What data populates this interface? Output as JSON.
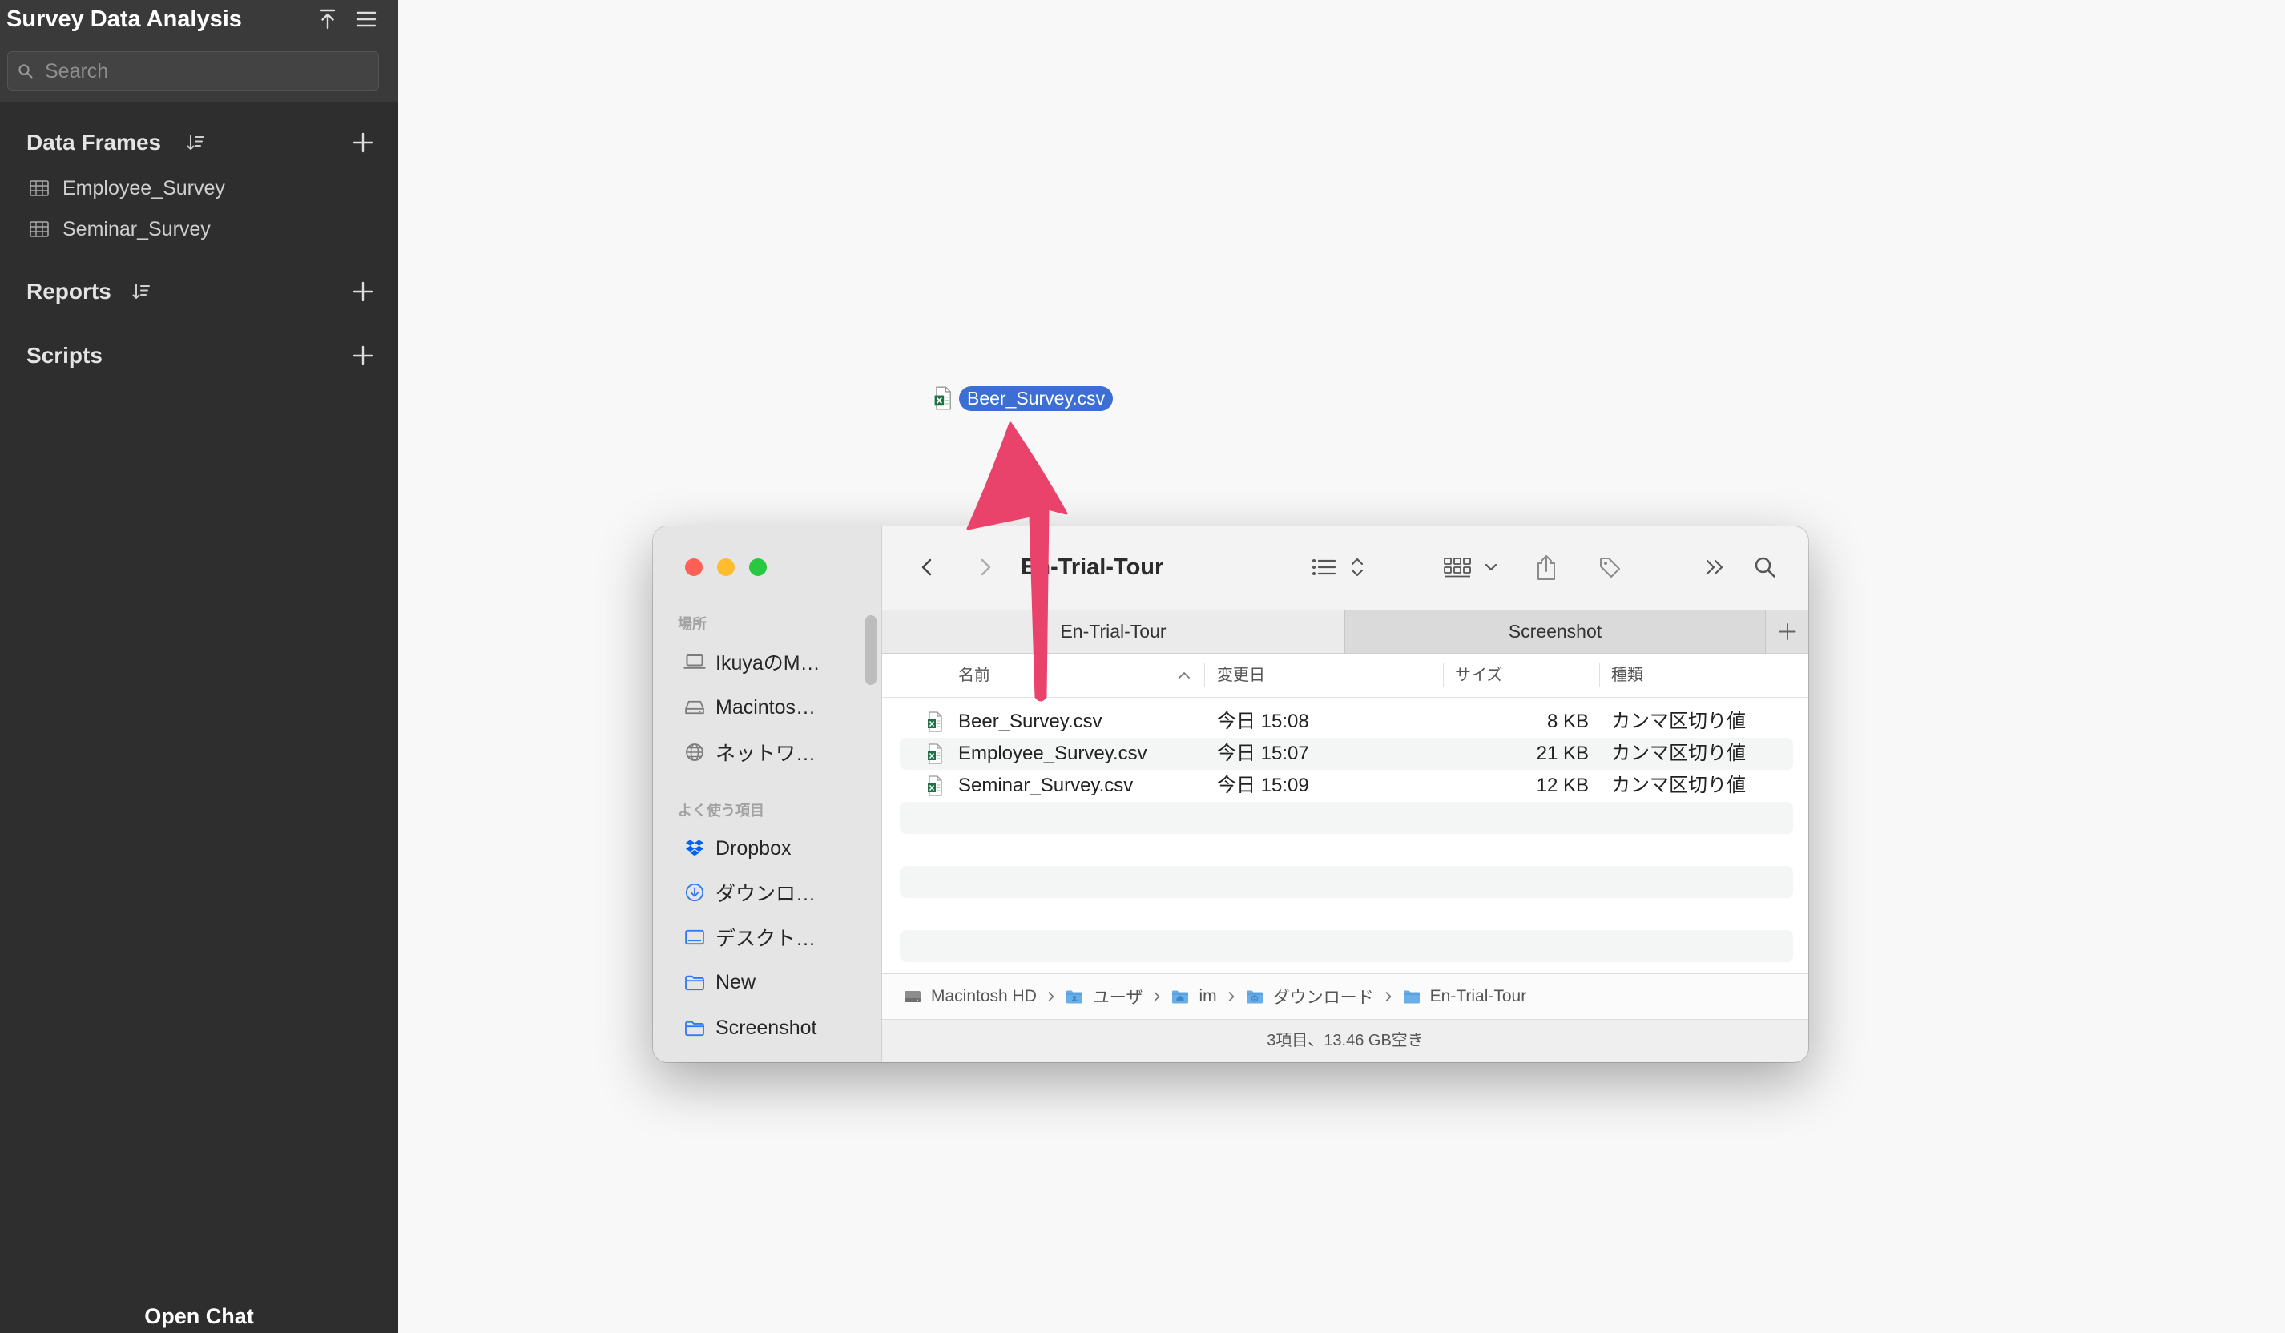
{
  "app": {
    "title": "Survey Data Analysis",
    "search_placeholder": "Search",
    "open_chat_label": "Open Chat"
  },
  "sidebar": {
    "data_frames": {
      "label": "Data Frames",
      "items": [
        {
          "label": "Employee_Survey",
          "icon": "table-icon"
        },
        {
          "label": "Seminar_Survey",
          "icon": "table-icon"
        }
      ]
    },
    "reports": {
      "label": "Reports"
    },
    "scripts": {
      "label": "Scripts"
    }
  },
  "drag_ghost": {
    "file_name": "Beer_Survey.csv",
    "icon": "csv-file-icon"
  },
  "finder": {
    "title": "En-Trial-Tour",
    "sidebar": {
      "places_label": "場所",
      "places": [
        {
          "label": "IkuyaのM…",
          "icon": "laptop-icon"
        },
        {
          "label": "Macintos…",
          "icon": "hard-drive-icon"
        },
        {
          "label": "ネットワ…",
          "icon": "network-globe-icon"
        }
      ],
      "favorites_label": "よく使う項目",
      "favorites": [
        {
          "label": "Dropbox",
          "icon": "dropbox-icon"
        },
        {
          "label": "ダウンロ…",
          "icon": "download-icon"
        },
        {
          "label": "デスクト…",
          "icon": "desktop-icon"
        },
        {
          "label": "New",
          "icon": "folder-icon"
        },
        {
          "label": "Screenshot",
          "icon": "folder-icon"
        }
      ]
    },
    "tabs": [
      {
        "label": "En-Trial-Tour",
        "active": true
      },
      {
        "label": "Screenshot",
        "active": false
      }
    ],
    "columns": {
      "name": "名前",
      "modified": "変更日",
      "size": "サイズ",
      "kind": "種類"
    },
    "files": [
      {
        "name": "Beer_Survey.csv",
        "modified": "今日 15:08",
        "size": "8 KB",
        "kind": "カンマ区切り値"
      },
      {
        "name": "Employee_Survey.csv",
        "modified": "今日 15:07",
        "size": "21 KB",
        "kind": "カンマ区切り値"
      },
      {
        "name": "Seminar_Survey.csv",
        "modified": "今日 15:09",
        "size": "12 KB",
        "kind": "カンマ区切り値"
      }
    ],
    "path": [
      {
        "label": "Macintosh HD",
        "icon": "hard-drive-icon"
      },
      {
        "label": "ユーザ",
        "icon": "users-folder-icon"
      },
      {
        "label": "im",
        "icon": "home-folder-icon"
      },
      {
        "label": "ダウンロード",
        "icon": "downloads-folder-icon"
      },
      {
        "label": "En-Trial-Tour",
        "icon": "folder-icon"
      }
    ],
    "status": "3項目、13.46 GB空き"
  },
  "colors": {
    "sidebar_bg": "#2e2e2e",
    "sidebar_header_bg": "#3a3a3a",
    "selection": "#3b6fd4",
    "arrow": "#e9426b",
    "close": "#fe5f57",
    "minimize": "#febc2e",
    "zoom": "#28c840",
    "accent": "#3478f6"
  }
}
